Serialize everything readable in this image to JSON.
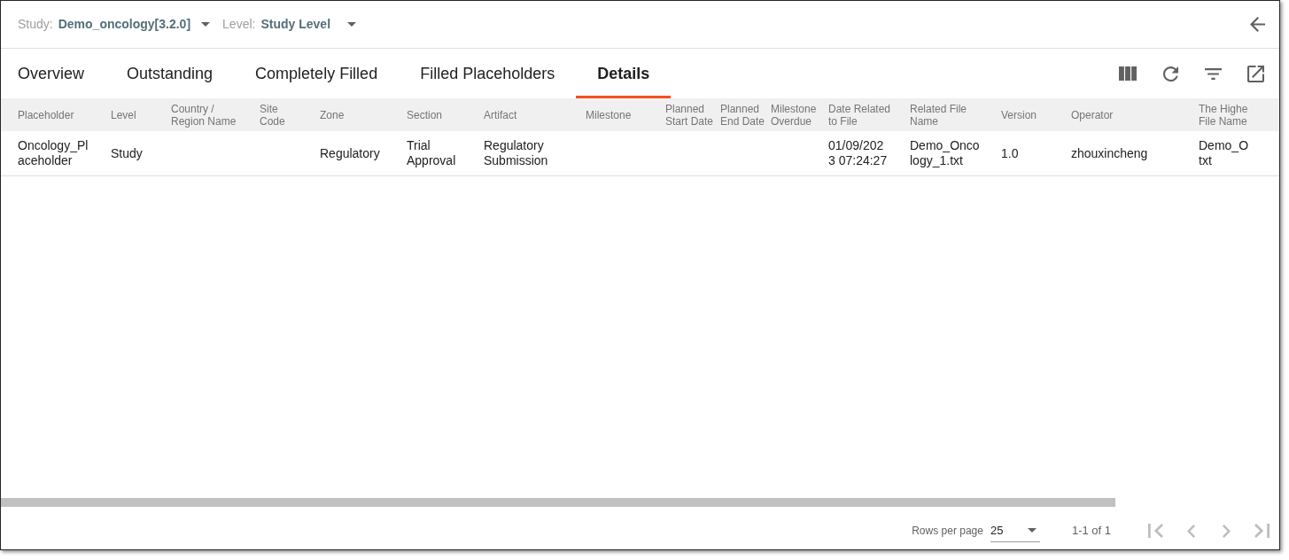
{
  "filters": [
    {
      "label": "Study:",
      "value": "Demo_oncology[3.2.0]"
    },
    {
      "label": "Level:",
      "value": "Study Level"
    }
  ],
  "tabs": [
    {
      "label": "Overview",
      "selected": false
    },
    {
      "label": "Outstanding",
      "selected": false
    },
    {
      "label": "Completely Filled",
      "selected": false
    },
    {
      "label": "Filled Placeholders",
      "selected": false
    },
    {
      "label": "Details",
      "selected": true
    }
  ],
  "toolbar": [
    {
      "kind": "columns"
    },
    {
      "kind": "refresh"
    },
    {
      "kind": "filter"
    },
    {
      "kind": "export"
    }
  ],
  "table": {
    "columns": [
      "Placeholder",
      "Level",
      "Country / Region Name",
      "Site Code",
      "Zone",
      "Section",
      "Artifact",
      "Milestone",
      "Planned Start Date",
      "Planned End Date",
      "Milestone Overdue",
      "Date Related to File",
      "Related File Name",
      "Version",
      "Operator",
      "The Highe File Name"
    ],
    "rows": [
      [
        "Oncology_Placeholder",
        "Study",
        null,
        null,
        "Regulatory",
        "Trial Approval",
        "Regulatory Submission",
        null,
        null,
        null,
        null,
        "01/09/2023 07:24:27",
        "Demo_Oncology_1.txt",
        "1.0",
        "zhouxincheng",
        "Demo_O txt"
      ]
    ]
  },
  "pagination": {
    "rows_per_page_label": "Rows per page",
    "rows_per_page": "25",
    "range": "1-1 of 1",
    "buttons": [
      {
        "kind": "first",
        "disabled": true
      },
      {
        "kind": "previous",
        "disabled": true
      },
      {
        "kind": "next",
        "disabled": true
      },
      {
        "kind": "last",
        "disabled": true
      }
    ]
  }
}
